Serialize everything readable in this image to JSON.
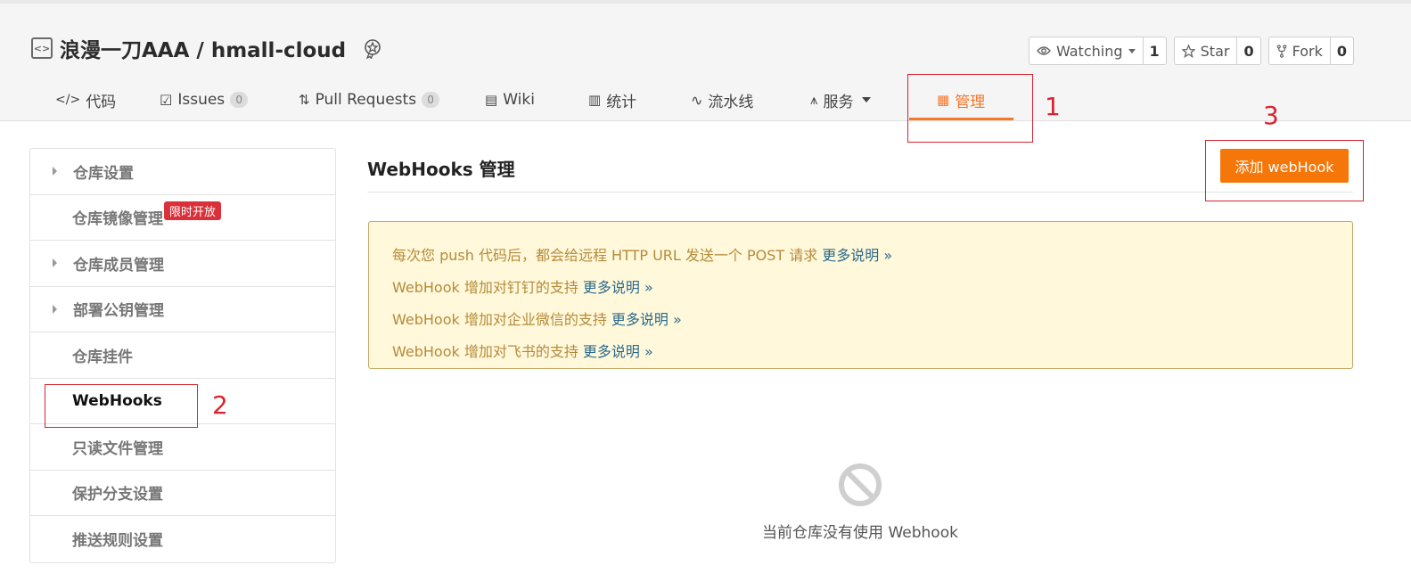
{
  "repo": {
    "title": "浪漫一刀AAA / hmall-cloud",
    "icon": "code-square-icon",
    "badge_icon": "award-badge-icon"
  },
  "actions": [
    {
      "label": "Watching",
      "count": "1",
      "icon": "eye-icon"
    },
    {
      "label": "Star",
      "count": "0",
      "icon": "star-icon"
    },
    {
      "label": "Fork",
      "count": "0",
      "icon": "fork-icon"
    }
  ],
  "tabs": [
    {
      "label": "代码",
      "icon": "code-icon",
      "glyph": "</>"
    },
    {
      "label": "Issues",
      "count": "0",
      "icon": "issues-icon",
      "glyph": "☑"
    },
    {
      "label": "Pull Requests",
      "count": "0",
      "icon": "pull-request-icon",
      "glyph": "⇅"
    },
    {
      "label": "Wiki",
      "icon": "book-icon",
      "glyph": "▤"
    },
    {
      "label": "统计",
      "icon": "chart-icon",
      "glyph": "▥"
    },
    {
      "label": "流水线",
      "icon": "pipeline-icon",
      "glyph": "∿"
    },
    {
      "label": "服务",
      "icon": "pulse-icon",
      "glyph": "⩚"
    },
    {
      "label": "管理",
      "icon": "manage-icon",
      "glyph": "▦"
    }
  ],
  "sidebar": {
    "items": [
      {
        "label": "仓库设置"
      },
      {
        "label": "仓库镜像管理",
        "badge": "限时开放"
      },
      {
        "label": "仓库成员管理"
      },
      {
        "label": "部署公钥管理"
      },
      {
        "label": "仓库挂件"
      },
      {
        "label": "WebHooks"
      },
      {
        "label": "只读文件管理"
      },
      {
        "label": "保护分支设置"
      },
      {
        "label": "推送规则设置"
      }
    ]
  },
  "main": {
    "title": "WebHooks 管理",
    "add_button": "添加 webHook",
    "info": [
      {
        "text": "每次您 push 代码后，都会给远程 HTTP URL 发送一个 POST 请求",
        "more": "更多说明 »"
      },
      {
        "text": "WebHook 增加对钉钉的支持",
        "more": "更多说明 »"
      },
      {
        "text": "WebHook 增加对企业微信的支持",
        "more": "更多说明 »"
      },
      {
        "text": "WebHook 增加对飞书的支持",
        "more": "更多说明 »"
      }
    ],
    "empty_text": "当前仓库没有使用 Webhook",
    "empty_icon": "prohibited-icon"
  },
  "annotations": [
    "1",
    "2",
    "3"
  ],
  "colors": {
    "accent": "#f5772a",
    "annotation": "#d9232e",
    "info_bg": "#fff8db",
    "info_text": "#b58a3a",
    "link": "#2c6a8a"
  }
}
